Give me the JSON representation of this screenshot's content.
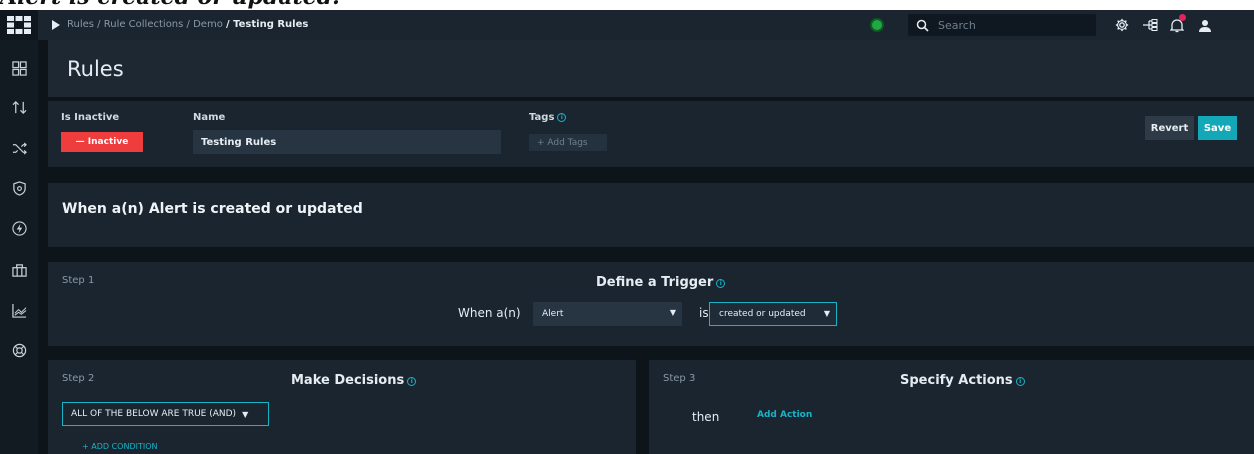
{
  "document": {
    "heading_fragment": "Alert is created or updated."
  },
  "topbar": {
    "breadcrumb": [
      "Rules",
      "Rule Collections",
      "Demo"
    ],
    "breadcrumb_current": "Testing Rules",
    "search_placeholder": "Search"
  },
  "page": {
    "title": "Rules"
  },
  "rule": {
    "inactive_label": "Is Inactive",
    "inactive_value": "— Inactive",
    "name_label": "Name",
    "name_value": "Testing Rules",
    "tags_label": "Tags",
    "tags_placeholder": "+ Add Tags",
    "revert_label": "Revert",
    "save_label": "Save"
  },
  "trigger_summary": "When a(n) Alert is created or updated",
  "step1": {
    "step_label": "Step 1",
    "title": "Define a Trigger",
    "when_label": "When a(n)",
    "module_value": "Alert",
    "is_label": "is",
    "event_value": "created or updated"
  },
  "step2": {
    "step_label": "Step 2",
    "title": "Make Decisions",
    "logic_value": "ALL OF THE BELOW ARE TRUE (AND)",
    "add_condition": "+ ADD CONDITION"
  },
  "step3": {
    "step_label": "Step 3",
    "title": "Specify Actions",
    "then_label": "then",
    "add_action": "Add Action"
  },
  "icons": {
    "sidebar": [
      "dashboard-icon",
      "sort-icon",
      "shuffle-icon",
      "shield-icon",
      "lightning-icon",
      "briefcase-icon",
      "chart-icon",
      "lifebuoy-icon"
    ],
    "topbar": [
      "gear-icon",
      "flow-icon",
      "bell-icon",
      "user-icon"
    ]
  },
  "colors": {
    "accent": "#13a8b8",
    "danger": "#ef3c3c",
    "status_ok": "#1fa844"
  }
}
